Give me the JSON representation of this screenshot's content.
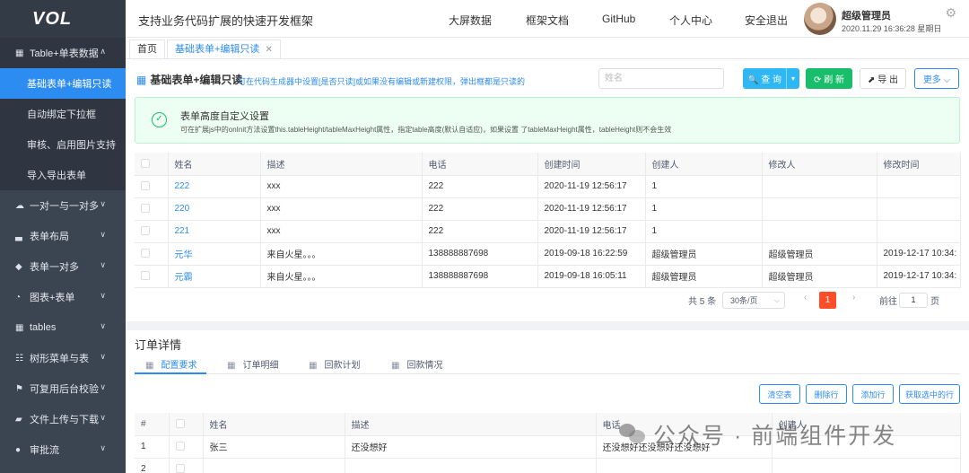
{
  "brand": {
    "logo": "VOL"
  },
  "sidebar": {
    "items": [
      {
        "label": "Table+单表数据",
        "icon": "grid-icon",
        "chev": "∧"
      },
      {
        "label": "一对一与一对多",
        "icon": "cloud-icon",
        "chev": "∨"
      },
      {
        "label": "表单布局",
        "icon": "bar-chart-icon",
        "chev": "∨"
      },
      {
        "label": "表单一对多",
        "icon": "cube-icon",
        "chev": "∨"
      },
      {
        "label": "图表+表单",
        "icon": "pie-chart-icon",
        "chev": "∨"
      },
      {
        "label": "tables",
        "icon": "grid-icon",
        "chev": "∨"
      },
      {
        "label": "树形菜单与表",
        "icon": "tree-icon",
        "chev": "∨"
      },
      {
        "label": "可复用后台校验",
        "icon": "tag-icon",
        "chev": "∨"
      },
      {
        "label": "文件上传与下载",
        "icon": "folder-icon",
        "chev": "∨"
      },
      {
        "label": "审批流",
        "icon": "dot-icon",
        "chev": "∨"
      }
    ],
    "subitems": [
      "基础表单+编辑只读",
      "自动绑定下拉框",
      "审核、启用图片支持",
      "导入导出表单"
    ]
  },
  "header": {
    "title": "支持业务代码扩展的快速开发框架",
    "nav": [
      "大屏数据",
      "框架文档",
      "GitHub",
      "个人中心",
      "安全退出"
    ],
    "user_name": "超级管理员",
    "user_date": "2020.11.29 16:36:28 星期日"
  },
  "tabs": {
    "home": "首页",
    "current": "基础表单+编辑只读",
    "close": "✕"
  },
  "main": {
    "title": "基础表单+编辑只读",
    "hint": "可在代码生成器中设置[是否只读]或如果没有编辑或新建权限，弹出框都是只读的",
    "search_placeholder": "姓名",
    "btn_query": "🔍 查 询",
    "btn_query_drop": "▾",
    "btn_refresh": "⟳ 刷 新",
    "btn_export": "⬈ 导 出",
    "btn_more": "更多 ⌵",
    "alert_title": "表单高度自定义设置",
    "alert_desc": "可在扩展js中的onInit方法设置this.tableHeight/tableMaxHeight属性，指定table高度(默认自适应)，如果设置 了tableMaxHeight属性，tableHeight则不会生效",
    "table": {
      "headers": [
        "姓名",
        "描述",
        "电话",
        "创建时间",
        "创建人",
        "修改人",
        "修改时间"
      ],
      "rows": [
        [
          "222",
          "xxx",
          "222",
          "2020-11-19 12:56:17",
          "1",
          "",
          ""
        ],
        [
          "220",
          "xxx",
          "222",
          "2020-11-19 12:56:17",
          "1",
          "",
          ""
        ],
        [
          "221",
          "xxx",
          "222",
          "2020-11-19 12:56:17",
          "1",
          "",
          ""
        ],
        [
          "元华",
          "来自火星。。。",
          "138888887698",
          "2019-09-18 16:22:59",
          "超级管理员",
          "超级管理员",
          "2019-12-17 10:34:"
        ],
        [
          "元霸",
          "来自火星。。。",
          "138888887698",
          "2019-09-18 16:05:11",
          "超级管理员",
          "超级管理员",
          "2019-12-17 10:34:"
        ]
      ]
    },
    "pager": {
      "total": "共 5 条",
      "page_size": "30条/页",
      "current": "1",
      "goto_label": "前往",
      "goto_value": "1",
      "page_label": "页"
    }
  },
  "detail": {
    "title": "订单详情",
    "tabs": [
      "配置要求",
      "订单明细",
      "回款计划",
      "回款情况"
    ],
    "buttons": [
      "清空表",
      "删除行",
      "添加行",
      "获取选中的行"
    ],
    "table": {
      "headers": [
        "#",
        "",
        "姓名",
        "描述",
        "电话",
        "创建人"
      ],
      "rows": [
        [
          "1",
          "",
          "张三",
          "还没想好",
          "还没想好还没想好还没想好",
          ""
        ],
        [
          "2",
          "",
          "",
          "",
          "",
          ""
        ]
      ]
    }
  },
  "watermark": "公众号 · 前端组件开发"
}
